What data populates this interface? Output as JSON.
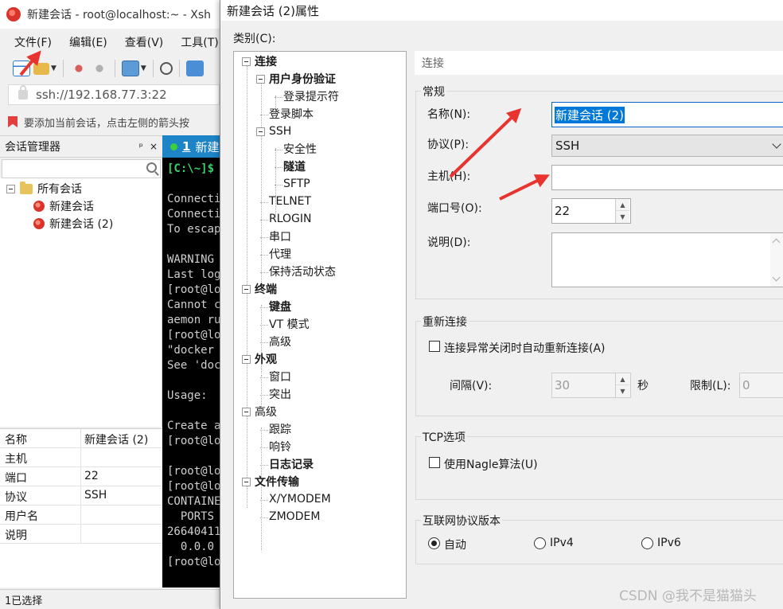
{
  "xshell": {
    "title": "新建会话 - root@localhost:~ - Xsh",
    "menu": [
      "文件(F)",
      "编辑(E)",
      "查看(V)",
      "工具(T)"
    ],
    "address": "ssh://192.168.77.3:22",
    "hint": "要添加当前会话，点击左侧的箭头按",
    "session_manager": {
      "title": "会话管理器",
      "pin": "ᵖ",
      "close": "×",
      "tree": {
        "root": "所有会话",
        "items": [
          "新建会话",
          "新建会话 (2)"
        ]
      }
    },
    "properties": [
      {
        "key": "名称",
        "value": "新建会话 (2)"
      },
      {
        "key": "主机",
        "value": ""
      },
      {
        "key": "端口",
        "value": "22"
      },
      {
        "key": "协议",
        "value": "SSH"
      },
      {
        "key": "用户名",
        "value": ""
      },
      {
        "key": "说明",
        "value": ""
      }
    ],
    "status": "1已选择",
    "terminal_tab": {
      "number": "1",
      "label": "新建"
    },
    "terminal_lines": [
      "[C:\\~]$",
      "",
      "Connecti",
      "Connecti",
      "To escap",
      "",
      "WARNING",
      "Last log",
      "[root@lo",
      "Cannot c",
      "aemon ru",
      "[root@lo",
      "\"docker",
      "See 'doc",
      "",
      "Usage:",
      "",
      "Create a",
      "[root@lo",
      "",
      "[root@lo",
      "[root@lo",
      "CONTAINE",
      "  PORTS",
      "26640411",
      "  0.0.0",
      "[root@lo"
    ]
  },
  "dialog": {
    "title": "新建会话 (2)属性",
    "category_label": "类别(C):",
    "categories": [
      {
        "label": "连接",
        "bold": true,
        "level": 0
      },
      {
        "label": "用户身份验证",
        "bold": true,
        "level": 1
      },
      {
        "label": "登录提示符",
        "bold": false,
        "level": 2
      },
      {
        "label": "登录脚本",
        "bold": false,
        "level": 1
      },
      {
        "label": "SSH",
        "bold": false,
        "level": 1
      },
      {
        "label": "安全性",
        "bold": false,
        "level": 2
      },
      {
        "label": "隧道",
        "bold": true,
        "level": 2
      },
      {
        "label": "SFTP",
        "bold": false,
        "level": 2
      },
      {
        "label": "TELNET",
        "bold": false,
        "level": 1
      },
      {
        "label": "RLOGIN",
        "bold": false,
        "level": 1
      },
      {
        "label": "串口",
        "bold": false,
        "level": 1
      },
      {
        "label": "代理",
        "bold": false,
        "level": 1
      },
      {
        "label": "保持活动状态",
        "bold": false,
        "level": 1
      },
      {
        "label": "终端",
        "bold": true,
        "level": 0
      },
      {
        "label": "键盘",
        "bold": true,
        "level": 1
      },
      {
        "label": "VT 模式",
        "bold": false,
        "level": 1
      },
      {
        "label": "高级",
        "bold": false,
        "level": 1
      },
      {
        "label": "外观",
        "bold": true,
        "level": 0
      },
      {
        "label": "窗口",
        "bold": false,
        "level": 1
      },
      {
        "label": "突出",
        "bold": false,
        "level": 1
      },
      {
        "label": "高级",
        "bold": false,
        "level": 0
      },
      {
        "label": "跟踪",
        "bold": false,
        "level": 1
      },
      {
        "label": "响铃",
        "bold": false,
        "level": 1
      },
      {
        "label": "日志记录",
        "bold": true,
        "level": 1
      },
      {
        "label": "文件传输",
        "bold": true,
        "level": 0
      },
      {
        "label": "X/YMODEM",
        "bold": false,
        "level": 1
      },
      {
        "label": "ZMODEM",
        "bold": false,
        "level": 1
      }
    ],
    "breadcrumb": "连接",
    "general": {
      "group": "常规",
      "name_label": "名称(N):",
      "name_value": "新建会话 (2)",
      "protocol_label": "协议(P):",
      "protocol_value": "SSH",
      "host_label": "主机(H):",
      "host_value": "",
      "port_label": "端口号(O):",
      "port_value": "22",
      "desc_label": "说明(D):",
      "desc_value": ""
    },
    "reconnect": {
      "group": "重新连接",
      "checkbox_label": "连接异常关闭时自动重新连接(A)",
      "interval_label": "间隔(V):",
      "interval_value": "30",
      "seconds": "秒",
      "limit_label": "限制(L):",
      "limit_value": "0"
    },
    "tcp": {
      "group": "TCP选项",
      "nagle_label": "使用Nagle算法(U)"
    },
    "ip_version": {
      "group": "互联网协议版本",
      "options": [
        "自动",
        "IPv4",
        "IPv6"
      ],
      "selected": "自动"
    }
  },
  "watermark": "CSDN @我不是猫猫头",
  "colors": {
    "accent": "#0078d7",
    "annotation_arrow": "#e8332f",
    "terminal_tab": "#1d84c6"
  }
}
